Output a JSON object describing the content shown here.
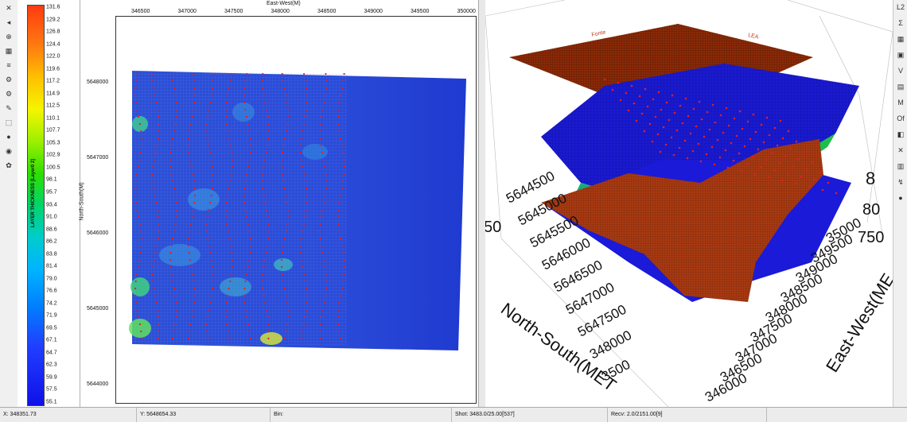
{
  "colorbar": {
    "title": "LAYER THICKNESS [Layer0 2]",
    "ticks": [
      "131.6",
      "129.2",
      "126.8",
      "124.4",
      "122.0",
      "119.6",
      "117.2",
      "114.9",
      "112.5",
      "110.1",
      "107.7",
      "105.3",
      "102.9",
      "100.5",
      "98.1",
      "95.7",
      "93.4",
      "91.0",
      "88.6",
      "86.2",
      "83.8",
      "81.4",
      "79.0",
      "76.6",
      "74.2",
      "71.9",
      "69.5",
      "67.1",
      "64.7",
      "62.3",
      "59.9",
      "57.5",
      "55.1"
    ]
  },
  "map": {
    "x_title": "East-West(M)",
    "y_title": "North-South(M)",
    "x_ticks": [
      "346500",
      "347000",
      "347500",
      "348000",
      "348500",
      "349000",
      "349500",
      "350000"
    ],
    "y_ticks": [
      "5648000",
      "5647000",
      "5646000",
      "5645000",
      "5644000"
    ]
  },
  "view3d": {
    "z_ticks": [
      "750",
      "80",
      "8"
    ],
    "ns_title": "North-South(MET",
    "ns_ticks": [
      "5644500",
      "5645000",
      "5645500",
      "5646000",
      "5646500",
      "5647000",
      "5647500",
      "348000",
      "3500"
    ],
    "ew_title": "East-West(ME",
    "ew_ticks": [
      "346000",
      "346500",
      "347000",
      "347500",
      "348000",
      "348500",
      "349000",
      "349500",
      "35000"
    ],
    "z_left": "50",
    "top_labels": [
      "Fonte",
      "LEA"
    ]
  },
  "toolbar_right_labels": [
    "L2",
    "Σ",
    "V",
    "M",
    "Of"
  ],
  "status": {
    "x": "X: 348351.73",
    "y": "Y: 5648654.33",
    "bin": "Bin:",
    "shot": "Shot: 3483.0/25.00[537]",
    "recv": "Recv: 2.0/2151.00[9]"
  },
  "colors": {
    "map_blue": "#1f3fd0",
    "surface_brown": "#a03a12",
    "surface_blue": "#1a1ad8",
    "shot_red": "#e02020"
  }
}
